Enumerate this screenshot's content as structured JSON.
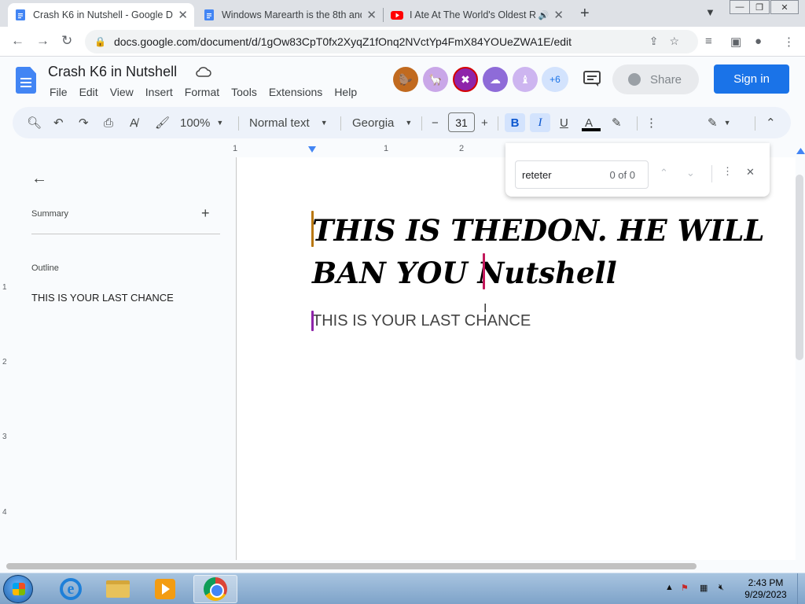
{
  "browser": {
    "tabs": [
      {
        "title": "Crash K6 in Nutshell - Google Docs",
        "icon": "google-docs-icon",
        "active": true
      },
      {
        "title": "Windows Marearth is the 8th and",
        "icon": "google-docs-icon",
        "active": false
      },
      {
        "title": "I Ate At The World's Oldest R",
        "icon": "youtube-icon",
        "active": false,
        "audio": "🔊"
      }
    ],
    "new_tab": "+",
    "url": "docs.google.com/document/d/1gOw83CpT0fx2XyqZ1fOnq2NVctYp4FmX84YOUeZWA1E/edit"
  },
  "doc": {
    "title": "Crash K6 in Nutshell",
    "menu": [
      "File",
      "Edit",
      "View",
      "Insert",
      "Format",
      "Tools",
      "Extensions",
      "Help"
    ],
    "more_collaborators": "+6",
    "share_label": "Share",
    "signin_label": "Sign in"
  },
  "toolbar": {
    "zoom": "100%",
    "style": "Normal text",
    "font": "Georgia",
    "font_size": "31",
    "bold": "B",
    "italic": "I",
    "underline": "U",
    "text_color": "A",
    "text_color_value": "#000000"
  },
  "ruler": {
    "marks": [
      "1",
      "1",
      "2"
    ],
    "vmarks": [
      "1",
      "2",
      "3",
      "4"
    ]
  },
  "sidepanel": {
    "summary_label": "Summary",
    "outline_label": "Outline",
    "outline_items": [
      "THIS IS YOUR LAST CHANCE"
    ]
  },
  "document": {
    "heading_line1": "THIS IS THEDON. HE WILL",
    "heading_line2": "BAN YOU Nutshell",
    "subheading": "THIS IS YOUR LAST CHANCE"
  },
  "find": {
    "query": "reteter",
    "count": "0 of 0"
  },
  "taskbar": {
    "time": "2:43 PM",
    "date": "9/29/2023"
  },
  "colors": {
    "accent": "#1a73e8",
    "toolbar_bg": "#edf2fa",
    "cursor_orange": "#b9770e",
    "cursor_purple": "#8e24aa",
    "cursor_magenta": "#c2185b"
  }
}
